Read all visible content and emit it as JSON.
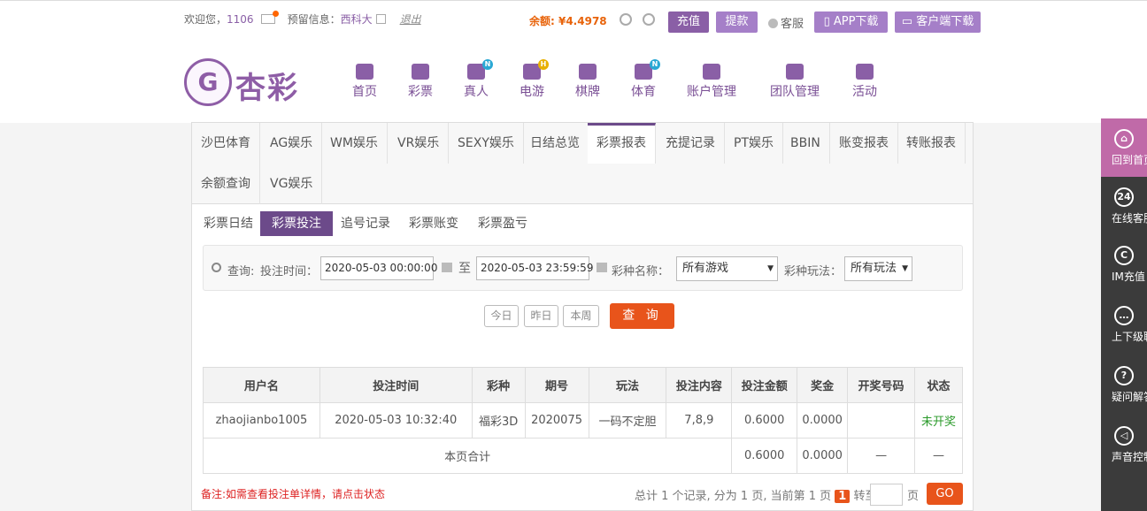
{
  "topbar": {
    "welcome": "欢迎您，",
    "username": "1106",
    "reserved_label": "预留信息：",
    "reserved_value": "西科大",
    "logout": "退出",
    "balance_label": "余额: ",
    "balance_value": "¥4.4978",
    "recharge": "充值",
    "withdraw": "提款",
    "service": "客服",
    "app_download": "APP下载",
    "client_download": "客户端下载",
    "colors": {
      "purple_button": "#8a5fa6",
      "purple_light": "#a57fc8",
      "orange": "#e8541b"
    }
  },
  "logo": {
    "mark": "G",
    "text": "杏彩"
  },
  "nav": {
    "items": [
      {
        "label": "首页",
        "icon": "home-icon"
      },
      {
        "label": "彩票",
        "icon": "lottery-icon"
      },
      {
        "label": "真人",
        "icon": "live-dealer-icon",
        "badge": "N"
      },
      {
        "label": "电游",
        "icon": "gamepad-icon",
        "badge": "H"
      },
      {
        "label": "棋牌",
        "icon": "cards-icon"
      },
      {
        "label": "体育",
        "icon": "trophy-icon",
        "badge": "N"
      },
      {
        "label": "账户管理",
        "icon": "account-icon"
      },
      {
        "label": "团队管理",
        "icon": "team-icon"
      },
      {
        "label": "活动",
        "icon": "gift-icon"
      }
    ]
  },
  "tabs": {
    "row1": [
      "沙巴体育",
      "AG娱乐",
      "WM娱乐",
      "VR娱乐",
      "SEXY娱乐",
      "日结总览",
      "彩票报表",
      "充提记录",
      "PT娱乐",
      "BBIN",
      "账变报表",
      "转账报表"
    ],
    "row2": [
      "余额查询",
      "VG娱乐"
    ],
    "active": "彩票报表"
  },
  "subtabs": {
    "items": [
      "彩票日结",
      "彩票投注",
      "追号记录",
      "彩票账变",
      "彩票盈亏"
    ],
    "active": "彩票投注"
  },
  "filter": {
    "query_label": "查询:",
    "time_label": "投注时间：",
    "start_time": "2020-05-03 00:00:00",
    "to": "至",
    "end_time": "2020-05-03 23:59:59",
    "lottery_label": "彩种名称：",
    "lottery_value": "所有游戏",
    "play_label": "彩种玩法：",
    "play_value": "所有玩法",
    "today": "今日",
    "yesterday": "昨日",
    "this_week": "本周",
    "query_button": "查 询"
  },
  "table": {
    "headers": [
      "用户名",
      "投注时间",
      "彩种",
      "期号",
      "玩法",
      "投注内容",
      "投注金额",
      "奖金",
      "开奖号码",
      "状态"
    ],
    "rows": [
      [
        "zhaojianbo1005",
        "2020-05-03 10:32:40",
        "福彩3D",
        "2020075",
        "一码不定胆",
        "7,8,9",
        "0.6000",
        "0.0000",
        "",
        "未开奖"
      ]
    ],
    "subtotal": {
      "label": "本页合计",
      "amount": "0.6000",
      "prize": "0.0000",
      "draw": "—",
      "status": "—"
    }
  },
  "footer": {
    "note": "备注:如需查看投注单详情，请点击状态",
    "pager_text": "总计 1 个记录, 分为 1 页, 当前第 1 页",
    "current_page": "1",
    "goto": "转至",
    "page_unit": "页",
    "go": "GO"
  },
  "sidebar": {
    "items": [
      {
        "label": "回到首页",
        "icon": "home-icon"
      },
      {
        "label": "在线客服",
        "icon": "support-24-icon",
        "glyph": "24"
      },
      {
        "label": "IM充值",
        "icon": "im-recharge-icon",
        "glyph": "C"
      },
      {
        "label": "上下级聊",
        "icon": "chat-icon",
        "glyph": "…"
      },
      {
        "label": "疑问解答",
        "icon": "help-icon",
        "glyph": "?"
      },
      {
        "label": "声音控制",
        "icon": "sound-icon",
        "glyph": "◁"
      }
    ]
  }
}
